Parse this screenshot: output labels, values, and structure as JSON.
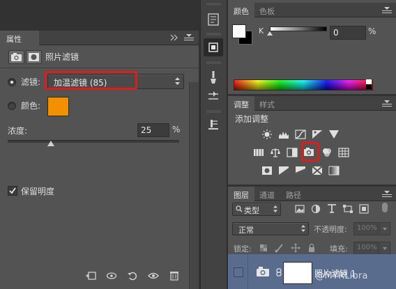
{
  "properties_panel": {
    "tab_label": "属性",
    "header_title": "照片滤镜",
    "filter_label": "滤镜:",
    "filter_value": "加温滤镜 (85)",
    "color_label": "颜色:",
    "color_swatch": "#f39000",
    "density_label": "浓度:",
    "density_value": "25",
    "density_unit": "%",
    "density_percent": 25,
    "preserve_luminosity_label": "保留明度",
    "preserve_luminosity_checked": true
  },
  "color_panel": {
    "tabs": [
      "颜色",
      "色板"
    ],
    "channel_label": "K",
    "k_value": "0",
    "k_unit": "%",
    "foreground": "#ffffff",
    "background": "#000000"
  },
  "adjustments_panel": {
    "tabs": [
      "调整",
      "样式"
    ],
    "add_label": "添加调整",
    "highlighted": "photo-filter"
  },
  "layers_panel": {
    "tabs": [
      "图层",
      "通道",
      "路径"
    ],
    "kind_filter": "类型",
    "blend_mode": "正常",
    "opacity_label": "不透明度:",
    "opacity_value": "100%",
    "lock_label": "锁定:",
    "fill_label": "填充:",
    "fill_value": "100%",
    "layer_name": "照片滤镜 1"
  },
  "watermark": "CSDN @MYRLibra",
  "colors": {
    "panel_bg": "#535353",
    "dark_bg": "#323232",
    "highlight_red": "#e21a1a",
    "selected_layer": "#596c8e"
  }
}
